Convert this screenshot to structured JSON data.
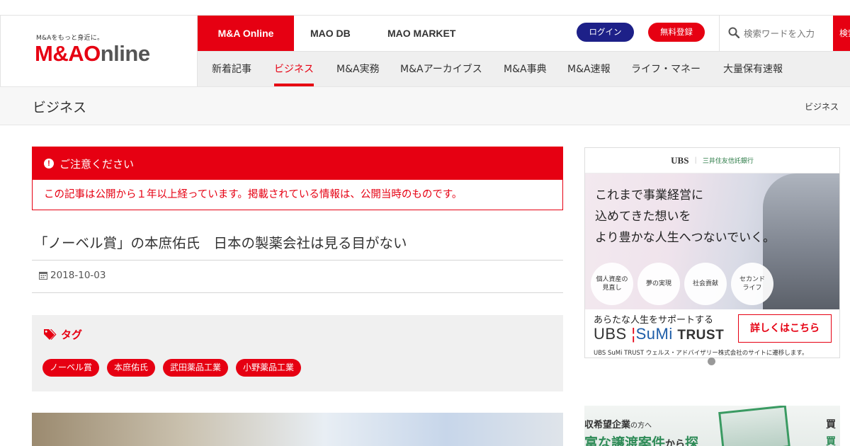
{
  "header": {
    "logo_tagline": "M&Aをもっと身近に。",
    "logo_text_red": "M&A",
    "logo_text_o": "O",
    "logo_text_gray": "nline",
    "tabs": [
      "M&A Online",
      "MAO DB",
      "MAO MARKET"
    ],
    "login_label": "ログイン",
    "register_label": "無料登録",
    "search_placeholder": "検索ワードを入力",
    "search_button": "検索"
  },
  "subnav": {
    "items": [
      "新着記事",
      "ビジネス",
      "M&A実務",
      "M&Aアーカイブス",
      "M&A事典",
      "M&A速報",
      "ライフ・マネー",
      "大量保有速報"
    ],
    "active_index": 1
  },
  "page": {
    "title": "ビジネス",
    "breadcrumb": "ビジネス"
  },
  "notice": {
    "heading": "ご注意ください",
    "body": "この記事は公開から１年以上経っています。掲載されている情報は、公開当時のものです。"
  },
  "article": {
    "title": "「ノーベル賞」の本庶佑氏　日本の製薬会社は見る目がない",
    "date": "2018-10-03",
    "tags_heading": "タグ",
    "tags": [
      "ノーベル賞",
      "本庶佑氏",
      "武田薬品工業",
      "小野薬品工業"
    ]
  },
  "ad_ubs": {
    "logo_ubs": "UBS",
    "logo_partner": "三井住友信託銀行",
    "headline": [
      "これまで事業経営に",
      "込めてきた想いを",
      "より豊かな人生へつないでいく。"
    ],
    "circles": [
      "個人資産の\n見直し",
      "夢の実現",
      "社会貢献",
      "セカンド\nライフ"
    ],
    "sub": "あらたな人生をサポートする",
    "brand_ubs": "UBS",
    "brand_sumi": "SuMi",
    "brand_trust": "TRUST",
    "cta": "詳しくはこちら",
    "footnote": "UBS SuMi TRUST ウェルス・アドバイザリー株式会社のサイトに遷移します。"
  },
  "ad_second": {
    "line1_a": "収希望企業",
    "line1_b": "の方へ",
    "line2_a": "富な譲渡案件",
    "line2_b": "から",
    "line2_c": "探",
    "right_1": "買",
    "right_2": "買"
  },
  "colors": {
    "brand_red": "#e60012",
    "navy": "#1d2088",
    "subnav_bg": "#efefef"
  }
}
